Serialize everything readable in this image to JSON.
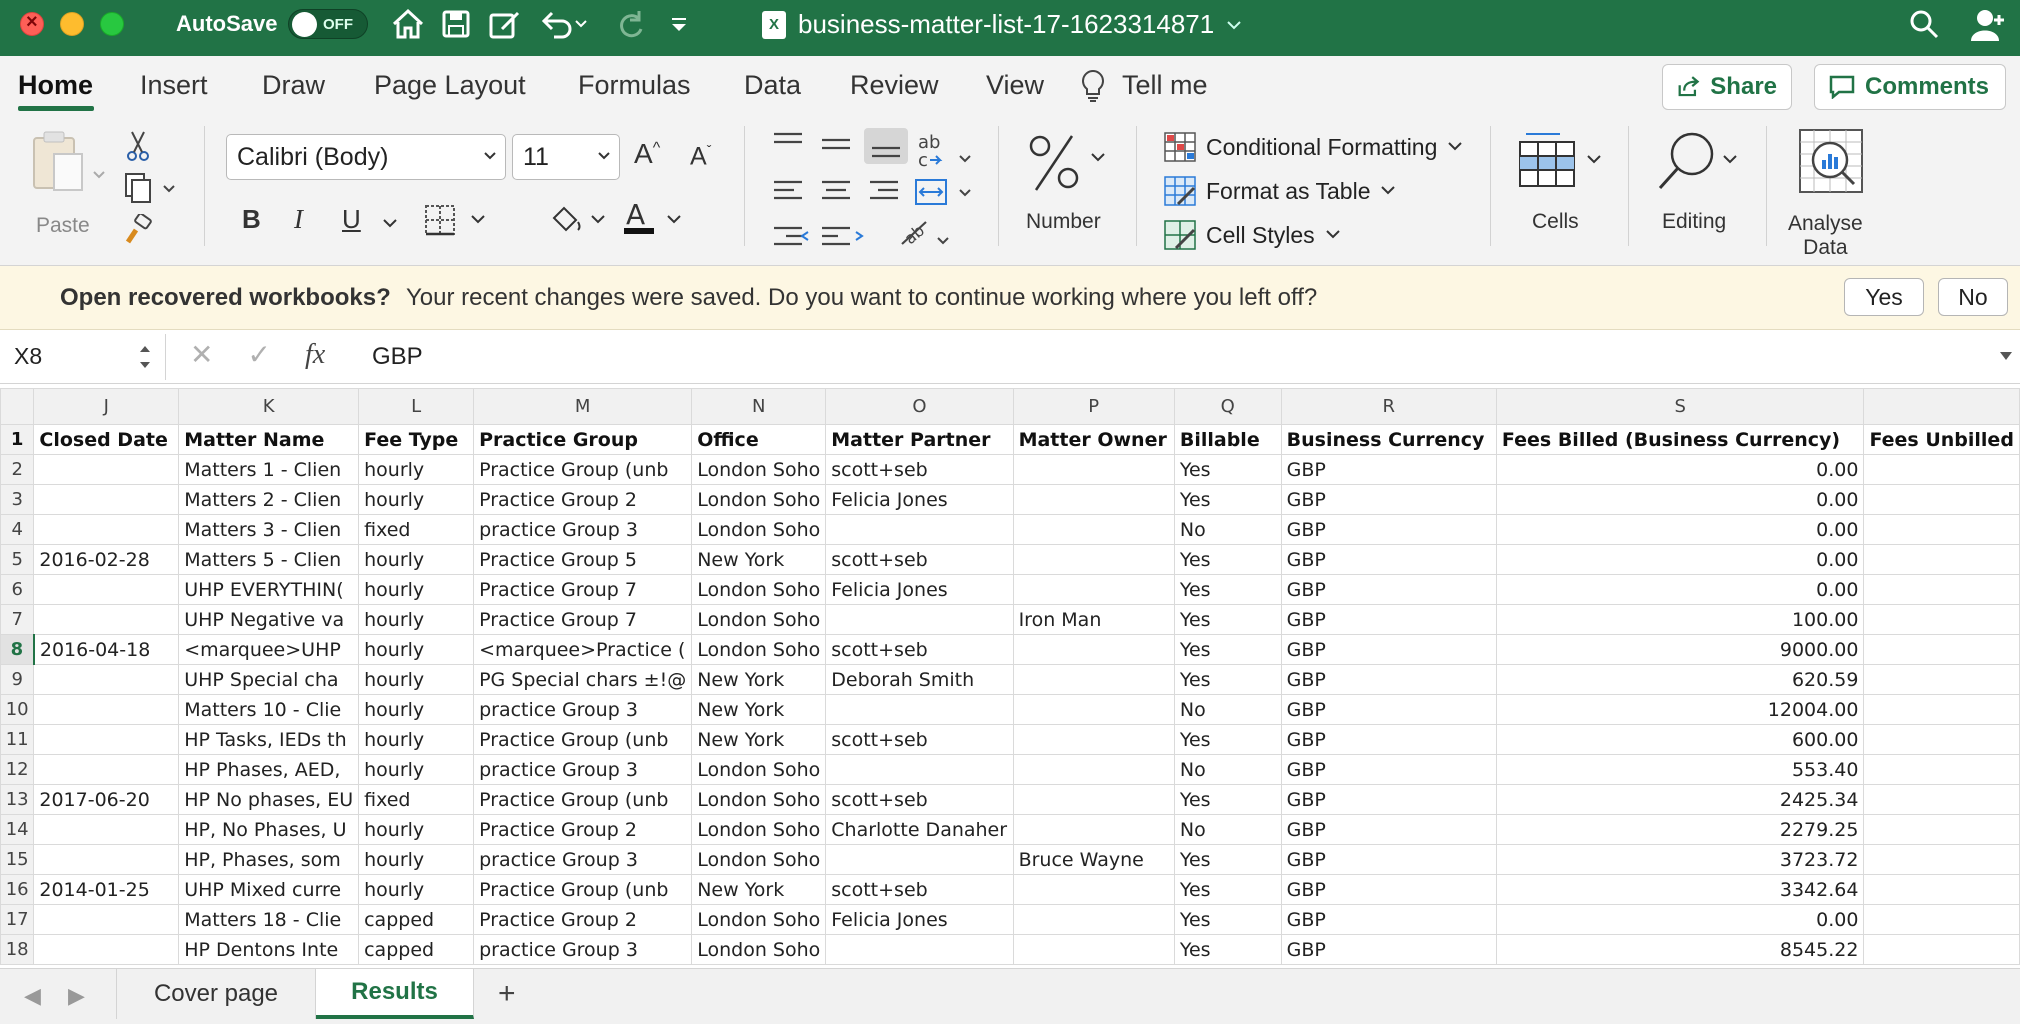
{
  "titlebar": {
    "autosave_label": "AutoSave",
    "autosave_state": "OFF",
    "document_title": "business-matter-list-17-1623314871"
  },
  "ribbon_tabs": [
    "Home",
    "Insert",
    "Draw",
    "Page Layout",
    "Formulas",
    "Data",
    "Review",
    "View"
  ],
  "tell_me": "Tell me",
  "share_label": "Share",
  "comments_label": "Comments",
  "ribbon": {
    "paste_label": "Paste",
    "font_name": "Calibri (Body)",
    "font_size": "11",
    "number_label": "Number",
    "conditional_formatting": "Conditional Formatting",
    "format_as_table": "Format as Table",
    "cell_styles": "Cell Styles",
    "cells_label": "Cells",
    "editing_label": "Editing",
    "analyse_label_1": "Analyse",
    "analyse_label_2": "Data",
    "bold": "B",
    "italic": "I",
    "underline": "U"
  },
  "recovery": {
    "title": "Open recovered workbooks?",
    "message": "Your recent changes were saved. Do you want to continue working where you left off?",
    "yes": "Yes",
    "no": "No"
  },
  "formula_bar": {
    "cell_ref": "X8",
    "formula": "GBP"
  },
  "sheet": {
    "columns": [
      "J",
      "K",
      "L",
      "M",
      "N",
      "O",
      "P",
      "Q",
      "R",
      "S",
      ""
    ],
    "rows": [
      {
        "n": "1",
        "cells": [
          "Closed Date",
          "Matter Name",
          "Fee Type",
          "Practice Group",
          "Office",
          "Matter Partner",
          "Matter Owner",
          "Billable",
          "Business Currency",
          "Fees Billed (Business Currency)",
          "Fees Unbilled"
        ]
      },
      {
        "n": "2",
        "cells": [
          "",
          "Matters 1 - Clien",
          "hourly",
          "Practice Group (unb",
          "London Soho",
          "scott+seb",
          "",
          "Yes",
          "GBP",
          "0.00",
          ""
        ]
      },
      {
        "n": "3",
        "cells": [
          "",
          "Matters 2 - Clien",
          "hourly",
          "Practice Group 2",
          "London Soho",
          "Felicia Jones",
          "",
          "Yes",
          "GBP",
          "0.00",
          ""
        ]
      },
      {
        "n": "4",
        "cells": [
          "",
          "Matters 3 - Clien",
          "fixed",
          "practice Group 3",
          "London Soho",
          "",
          "",
          "No",
          "GBP",
          "0.00",
          ""
        ]
      },
      {
        "n": "5",
        "cells": [
          "2016-02-28",
          "Matters 5 - Clien",
          "hourly",
          "Practice Group 5",
          "New York",
          "scott+seb",
          "",
          "Yes",
          "GBP",
          "0.00",
          ""
        ]
      },
      {
        "n": "6",
        "cells": [
          "",
          "UHP EVERYTHIN(",
          "hourly",
          "Practice Group 7",
          "London Soho",
          "Felicia Jones",
          "",
          "Yes",
          "GBP",
          "0.00",
          ""
        ]
      },
      {
        "n": "7",
        "cells": [
          "",
          "UHP Negative va",
          "hourly",
          "Practice Group 7",
          "London Soho",
          "",
          "Iron Man",
          "Yes",
          "GBP",
          "100.00",
          ""
        ]
      },
      {
        "n": "8",
        "cells": [
          "2016-04-18",
          "<marquee>UHP",
          "hourly",
          "<marquee>Practice (",
          "London Soho",
          "scott+seb",
          "",
          "Yes",
          "GBP",
          "9000.00",
          ""
        ]
      },
      {
        "n": "9",
        "cells": [
          "",
          "UHP Special cha",
          "hourly",
          "PG Special chars ±!@",
          "New York",
          "Deborah Smith",
          "",
          "Yes",
          "GBP",
          "620.59",
          ""
        ]
      },
      {
        "n": "10",
        "cells": [
          "",
          "Matters 10 - Clie",
          "hourly",
          "practice Group 3",
          "New York",
          "",
          "",
          "No",
          "GBP",
          "12004.00",
          ""
        ]
      },
      {
        "n": "11",
        "cells": [
          "",
          "HP Tasks, IEDs th",
          "hourly",
          "Practice Group (unb",
          "New York",
          "scott+seb",
          "",
          "Yes",
          "GBP",
          "600.00",
          ""
        ]
      },
      {
        "n": "12",
        "cells": [
          "",
          "HP Phases, AED,",
          "hourly",
          "practice Group 3",
          "London Soho",
          "",
          "",
          "No",
          "GBP",
          "553.40",
          ""
        ]
      },
      {
        "n": "13",
        "cells": [
          "2017-06-20",
          "HP No phases, EU",
          "fixed",
          "Practice Group (unb",
          "London Soho",
          "scott+seb",
          "",
          "Yes",
          "GBP",
          "2425.34",
          ""
        ]
      },
      {
        "n": "14",
        "cells": [
          "",
          "HP, No Phases, U",
          "hourly",
          "Practice Group 2",
          "London Soho",
          "Charlotte Danaher",
          "",
          "No",
          "GBP",
          "2279.25",
          ""
        ]
      },
      {
        "n": "15",
        "cells": [
          "",
          "HP, Phases, som",
          "hourly",
          "practice Group 3",
          "London Soho",
          "",
          "Bruce Wayne",
          "Yes",
          "GBP",
          "3723.72",
          ""
        ]
      },
      {
        "n": "16",
        "cells": [
          "2014-01-25",
          "UHP Mixed curre",
          "hourly",
          "Practice Group (unb",
          "New York",
          "scott+seb",
          "",
          "Yes",
          "GBP",
          "3342.64",
          ""
        ]
      },
      {
        "n": "17",
        "cells": [
          "",
          "Matters 18 - Clie",
          "capped",
          "Practice Group 2",
          "London Soho",
          "Felicia Jones",
          "",
          "Yes",
          "GBP",
          "0.00",
          ""
        ]
      },
      {
        "n": "18",
        "cells": [
          "",
          "HP Dentons Inte",
          "capped",
          "practice Group 3",
          "London Soho",
          "",
          "",
          "Yes",
          "GBP",
          "8545.22",
          ""
        ]
      }
    ]
  },
  "sheet_tabs": [
    "Cover page",
    "Results"
  ],
  "active_sheet": "Results",
  "colors": {
    "brand": "#217346",
    "recovery_bg": "#fdf7e3"
  }
}
